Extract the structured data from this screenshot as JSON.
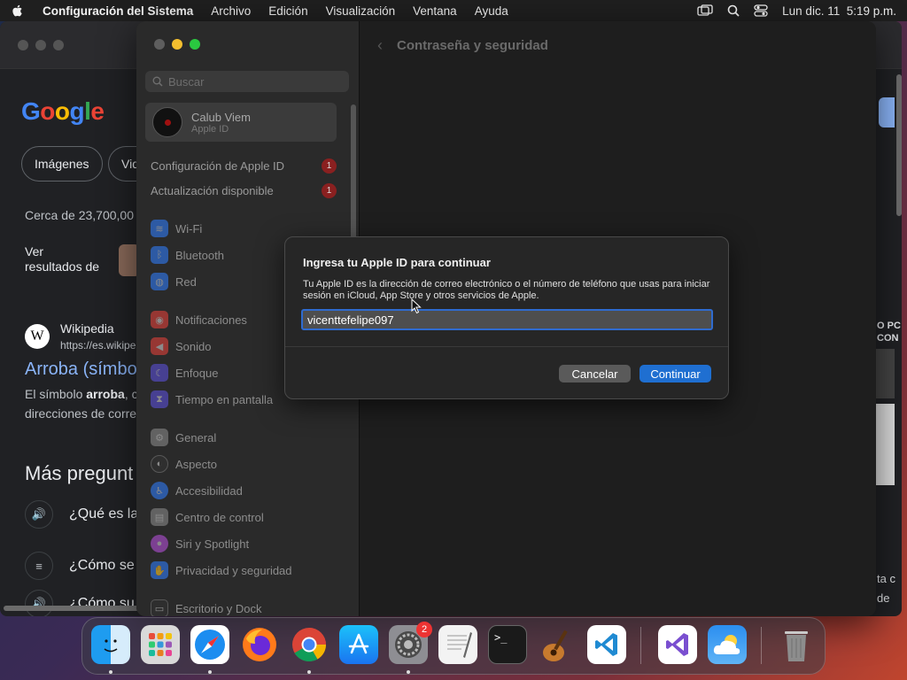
{
  "menubar": {
    "app_name": "Configuración del Sistema",
    "items": [
      "Archivo",
      "Edición",
      "Visualización",
      "Ventana",
      "Ayuda"
    ],
    "clock": "Lun dic. 11  5:19 p.m."
  },
  "browser": {
    "logo": "Google",
    "chips": [
      "Imágenes",
      "Vid"
    ],
    "results_count": "Cerca de 23,700,00",
    "ver_results": "Ver\nresultados de",
    "wiki_name": "Wikipedia",
    "wiki_url": "https://es.wikipe",
    "result_title": "Arroba (símbo",
    "snippet_line1_pre": "El símbolo ",
    "snippet_line1_bold": "arroba",
    "snippet_line1_post": ", c",
    "snippet_line2": "direcciones de corre",
    "more_questions": "Más pregunt",
    "questions": [
      "¿Qué es la",
      "¿Cómo se",
      "¿Cómo su"
    ],
    "edge_text_1": "O PC",
    "edge_text_2": "CON",
    "edge_text_3": "ta c",
    "edge_text_4": "de"
  },
  "settings": {
    "search_placeholder": "Buscar",
    "account_name": "Calub Viem",
    "account_sub": "Apple ID",
    "notices": [
      {
        "label": "Configuración de Apple ID",
        "badge": "1"
      },
      {
        "label": "Actualización disponible",
        "badge": "1"
      }
    ],
    "sidebar_items": [
      {
        "label": "Wi-Fi",
        "icon": "wifi-icon",
        "color": "#2f7bf5"
      },
      {
        "label": "Bluetooth",
        "icon": "bluetooth-icon",
        "color": "#2f7bf5"
      },
      {
        "label": "Red",
        "icon": "globe-icon",
        "color": "#2f7bf5"
      },
      {
        "label": "Notificaciones",
        "icon": "bell-icon",
        "color": "#e0413a"
      },
      {
        "label": "Sonido",
        "icon": "speaker-icon",
        "color": "#e0413a"
      },
      {
        "label": "Enfoque",
        "icon": "moon-icon",
        "color": "#5b4fd8"
      },
      {
        "label": "Tiempo en pantalla",
        "icon": "hourglass-icon",
        "color": "#5b4fd8"
      },
      {
        "label": "General",
        "icon": "gear-icon",
        "color": "#888888"
      },
      {
        "label": "Aspecto",
        "icon": "appearance-icon",
        "color": "#333333"
      },
      {
        "label": "Accesibilidad",
        "icon": "accessibility-icon",
        "color": "#2f7bf5"
      },
      {
        "label": "Centro de control",
        "icon": "control-center-icon",
        "color": "#888888"
      },
      {
        "label": "Siri y Spotlight",
        "icon": "siri-icon",
        "color": "#b34fd8"
      },
      {
        "label": "Privacidad y seguridad",
        "icon": "hand-icon",
        "color": "#2f7bf5"
      },
      {
        "label": "Escritorio y Dock",
        "icon": "desktop-icon",
        "color": "#333333"
      }
    ],
    "pane_title": "Contraseña y seguridad"
  },
  "dialog": {
    "title": "Ingresa tu Apple ID para continuar",
    "description": "Tu Apple ID es la dirección de correo electrónico o el número de teléfono que usas para iniciar sesión en iCloud, App Store y otros servicios de Apple.",
    "input_value": "vicenttefelipe097",
    "cancel_label": "Cancelar",
    "continue_label": "Continuar"
  },
  "dock": {
    "apps": [
      {
        "name": "finder-icon"
      },
      {
        "name": "launchpad-icon"
      },
      {
        "name": "safari-icon"
      },
      {
        "name": "firefox-icon"
      },
      {
        "name": "chrome-icon"
      },
      {
        "name": "app-store-icon"
      },
      {
        "name": "system-settings-icon",
        "badge": "2"
      },
      {
        "name": "textedit-icon"
      },
      {
        "name": "terminal-icon"
      },
      {
        "name": "garageband-icon"
      },
      {
        "name": "vscode-icon"
      },
      {
        "name": "visual-studio-icon"
      },
      {
        "name": "weather-icon"
      },
      {
        "name": "trash-icon"
      }
    ]
  },
  "colors": {
    "accent": "#1f6fd1",
    "badge": "#8a2020"
  }
}
